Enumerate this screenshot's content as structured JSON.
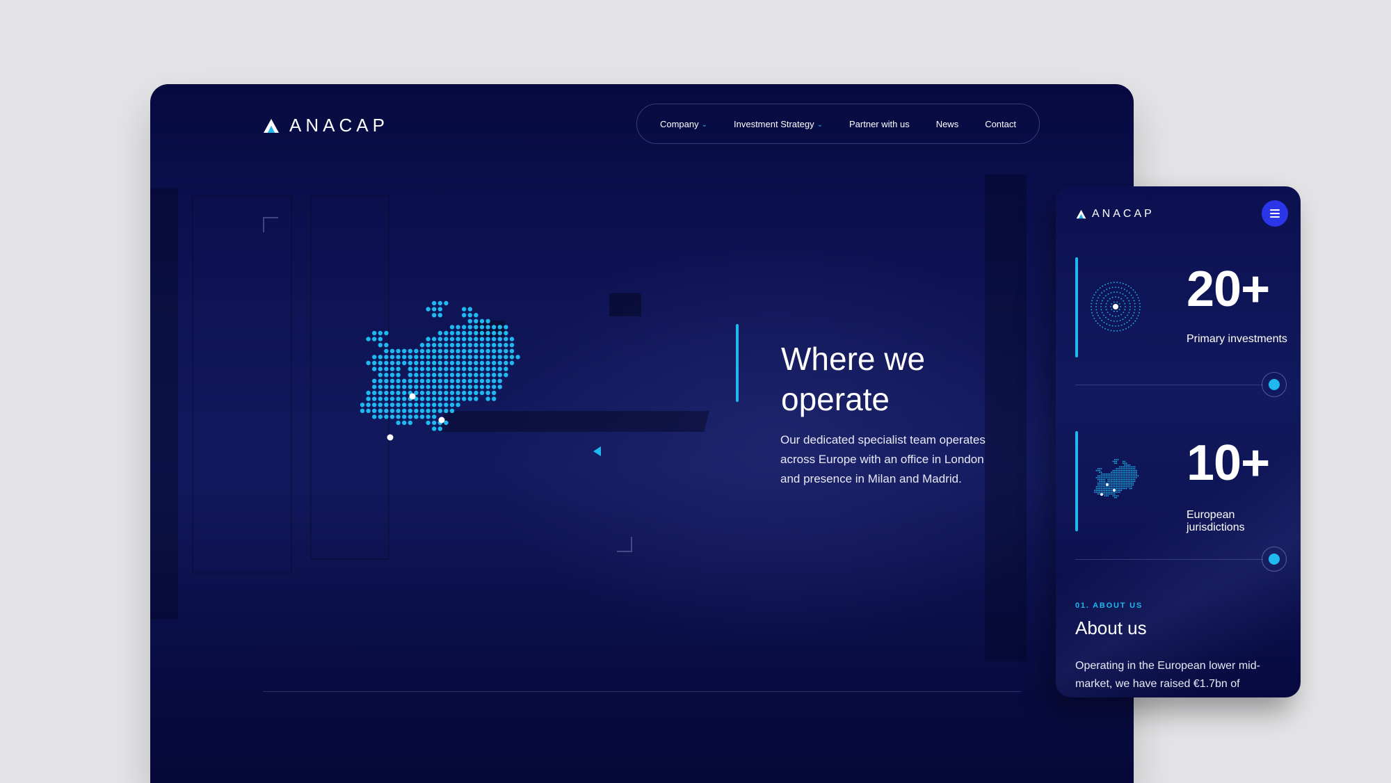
{
  "brand": {
    "name": "ANACAP"
  },
  "nav": {
    "items": [
      {
        "label": "Company",
        "has_dropdown": true
      },
      {
        "label": "Investment Strategy",
        "has_dropdown": true
      },
      {
        "label": "Partner with us",
        "has_dropdown": false
      },
      {
        "label": "News",
        "has_dropdown": false
      },
      {
        "label": "Contact",
        "has_dropdown": false
      }
    ]
  },
  "hero": {
    "title": "Where we operate",
    "description": "Our dedicated specialist team operates across Europe with an office in London and presence in Milan and Madrid."
  },
  "mobile": {
    "brand": "ANACAP",
    "stats": [
      {
        "value": "20+",
        "label": "Primary investments",
        "icon": "globe-dots-icon"
      },
      {
        "value": "10+",
        "label": "European jurisdictions",
        "icon": "europe-map-icon"
      }
    ],
    "section": {
      "kicker": "01.  ABOUT US",
      "title": "About us",
      "body": "Operating in the European lower mid-market, we have raised €1.7bn of"
    }
  },
  "colors": {
    "accent": "#1fb8f0",
    "background": "#0c1150",
    "menu_button": "#2a36e8",
    "page_bg": "#e4e4e6"
  }
}
